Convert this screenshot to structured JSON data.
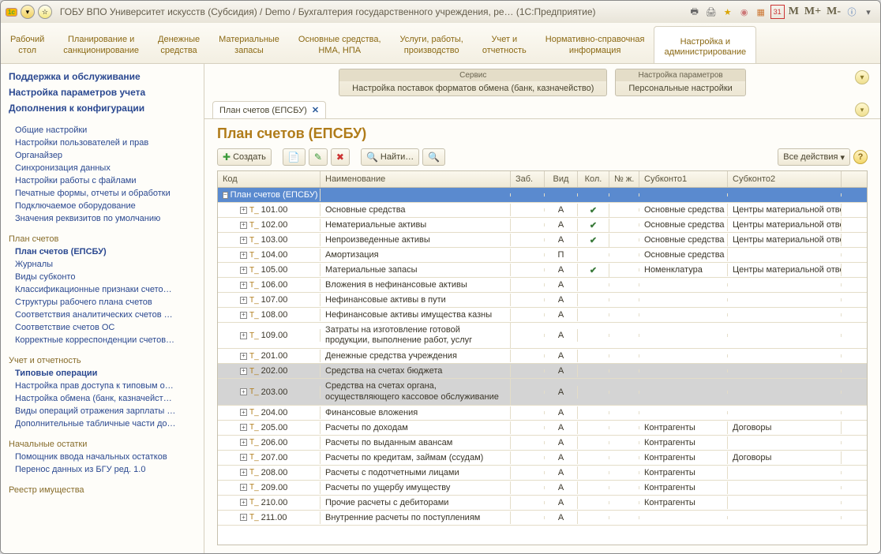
{
  "titlebar": {
    "title": "ГОБУ ВПО Университет искусств (Субсидия) / Demo / Бухгалтерия государственного учреждения, ре…   (1С:Предприятие)",
    "m_buttons": [
      "M",
      "M+",
      "M-"
    ]
  },
  "menubar": [
    {
      "l1": "Рабочий",
      "l2": "стол"
    },
    {
      "l1": "Планирование и",
      "l2": "санкционирование"
    },
    {
      "l1": "Денежные",
      "l2": "средства"
    },
    {
      "l1": "Материальные",
      "l2": "запасы"
    },
    {
      "l1": "Основные средства,",
      "l2": "НМА, НПА"
    },
    {
      "l1": "Услуги, работы,",
      "l2": "производство"
    },
    {
      "l1": "Учет и",
      "l2": "отчетность"
    },
    {
      "l1": "Нормативно-справочная",
      "l2": "информация"
    },
    {
      "l1": "Настройка и",
      "l2": "администрирование",
      "active": true
    }
  ],
  "sidebar": {
    "headings": [
      "Поддержка и обслуживание",
      "Настройка параметров учета",
      "Дополнения к конфигурации"
    ],
    "sections": [
      {
        "title": "",
        "items": [
          "Общие настройки",
          "Настройки пользователей и прав",
          "Органайзер",
          "Синхронизация данных",
          "Настройки работы с файлами",
          "Печатные формы, отчеты и обработки",
          "Подключаемое оборудование",
          "Значения реквизитов по умолчанию"
        ]
      },
      {
        "title": "План счетов",
        "items": [
          {
            "t": "План счетов (ЕПСБУ)",
            "b": true
          },
          "Журналы",
          "Виды субконто",
          "Классификационные признаки счето…",
          "Структуры рабочего плана счетов",
          "Соответствия аналитических счетов …",
          "Соответствие счетов ОС",
          "Корректные корреспонденции счетов…"
        ]
      },
      {
        "title": "Учет и отчетность",
        "items": [
          {
            "t": "Типовые операции",
            "b": true
          },
          "Настройка прав доступа к типовым о…",
          "Настройка обмена (банк, казначейст…",
          "Виды операций отражения зарплаты …",
          "Дополнительные табличные части до…"
        ]
      },
      {
        "title": "Начальные остатки",
        "items": [
          "Помощник ввода начальных остатков",
          "Перенос данных из БГУ ред. 1.0"
        ]
      },
      {
        "title": "Реестр имущества",
        "items": []
      }
    ]
  },
  "service": {
    "groups": [
      {
        "title": "Сервис",
        "items": [
          "Настройка поставок форматов обмена (банк, казначейство)"
        ]
      },
      {
        "title": "Настройка параметров",
        "items": [
          "Персональные настройки"
        ]
      }
    ]
  },
  "tab": {
    "label": "План счетов (ЕПСБУ)"
  },
  "page_title": "План счетов (ЕПСБУ)",
  "toolbar": {
    "create": "Создать",
    "find": "Найти…",
    "all_actions": "Все действия"
  },
  "grid": {
    "headers": {
      "code": "Код",
      "name": "Наименование",
      "zab": "Заб.",
      "vid": "Вид",
      "kol": "Кол.",
      "nz": "№ ж.",
      "sub1": "Субконто1",
      "sub2": "Субконто2"
    },
    "root": "План счетов (ЕПСБУ)",
    "rows": [
      {
        "code": "101.00",
        "name": "Основные средства",
        "vid": "А",
        "kol": true,
        "sub1": "Основные средства",
        "sub2": "Центры материальной отве"
      },
      {
        "code": "102.00",
        "name": "Нематериальные активы",
        "vid": "А",
        "kol": true,
        "sub1": "Основные средства",
        "sub2": "Центры материальной отве"
      },
      {
        "code": "103.00",
        "name": "Непроизведенные активы",
        "vid": "А",
        "kol": true,
        "sub1": "Основные средства",
        "sub2": "Центры материальной отве"
      },
      {
        "code": "104.00",
        "name": "Амортизация",
        "vid": "П",
        "sub1": "Основные средства"
      },
      {
        "code": "105.00",
        "name": "Материальные запасы",
        "vid": "А",
        "kol": true,
        "sub1": "Номенклатура",
        "sub2": "Центры материальной отве"
      },
      {
        "code": "106.00",
        "name": "Вложения в нефинансовые активы",
        "vid": "А"
      },
      {
        "code": "107.00",
        "name": "Нефинансовые активы в пути",
        "vid": "А"
      },
      {
        "code": "108.00",
        "name": "Нефинансовые активы имущества казны",
        "vid": "А"
      },
      {
        "code": "109.00",
        "name": "Затраты на изготовление готовой продукции, выполнение работ, услуг",
        "vid": "А",
        "multi": true
      },
      {
        "code": "201.00",
        "name": "Денежные средства учреждения",
        "vid": "А"
      },
      {
        "code": "202.00",
        "name": "Средства на счетах бюджета",
        "vid": "А",
        "gray": true
      },
      {
        "code": "203.00",
        "name": "Средства на счетах органа, осуществляющего кассовое обслуживание",
        "vid": "А",
        "gray": true,
        "multi": true
      },
      {
        "code": "204.00",
        "name": "Финансовые вложения",
        "vid": "А"
      },
      {
        "code": "205.00",
        "name": "Расчеты по доходам",
        "vid": "А",
        "sub1": "Контрагенты",
        "sub2": "Договоры"
      },
      {
        "code": "206.00",
        "name": "Расчеты по выданным авансам",
        "vid": "А",
        "sub1": "Контрагенты"
      },
      {
        "code": "207.00",
        "name": "Расчеты по кредитам, займам (ссудам)",
        "vid": "А",
        "sub1": "Контрагенты",
        "sub2": "Договоры"
      },
      {
        "code": "208.00",
        "name": "Расчеты с подотчетными лицами",
        "vid": "А",
        "sub1": "Контрагенты"
      },
      {
        "code": "209.00",
        "name": "Расчеты по ущербу имуществу",
        "vid": "А",
        "sub1": "Контрагенты"
      },
      {
        "code": "210.00",
        "name": "Прочие расчеты с дебиторами",
        "vid": "А",
        "sub1": "Контрагенты"
      },
      {
        "code": "211.00",
        "name": "Внутренние расчеты по поступлениям",
        "vid": "А",
        "cut": true
      }
    ]
  }
}
